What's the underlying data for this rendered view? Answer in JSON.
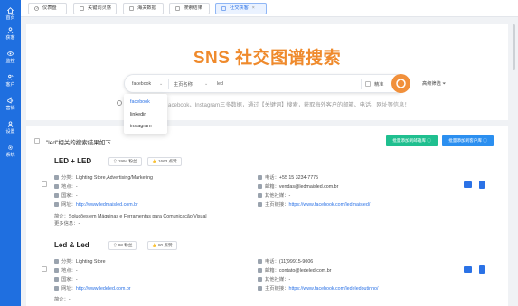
{
  "sidebar": {
    "items": [
      {
        "label": "首页",
        "icon": "home-icon"
      },
      {
        "label": "获客",
        "icon": "user-icon"
      },
      {
        "label": "监控",
        "icon": "eye-icon"
      },
      {
        "label": "客户",
        "icon": "customers-icon"
      },
      {
        "label": "营销",
        "icon": "marketing-icon"
      },
      {
        "label": "设置",
        "icon": "settings-icon"
      },
      {
        "label": "系统",
        "icon": "gear-icon"
      }
    ]
  },
  "tabs": [
    {
      "label": "仪表盘"
    },
    {
      "label": "关键词灵感"
    },
    {
      "label": "海关数据"
    },
    {
      "label": "搜索结果"
    },
    {
      "label": "社交获客",
      "close": "×"
    }
  ],
  "search": {
    "hero_title": "SNS 社交图谱搜索",
    "platform": "facebook",
    "field": "主页名称",
    "query": "led",
    "exact_label": "精准",
    "advanced_label": "高级筛选",
    "description": "acebook、Instagram三多数据，通过【关键词】搜索，获取海外客户的邮箱、电话、网址等信息！",
    "dropdown_options": [
      "facebook",
      "linkedin",
      "instagram"
    ]
  },
  "results": {
    "heading": "\"led\"相关的搜索结果如下",
    "btn_email": "批量添加到邮箱库 ⓘ",
    "btn_customers": "批量添加到客户库 ⓘ",
    "cards": [
      {
        "name": "LED + LED",
        "fans": "1994 粉丝",
        "likes": "1663 点赞",
        "category_label": "分类：",
        "category": "Lighting Store,Advertising/Marketing",
        "location_label": "地点：",
        "location": "-",
        "country_label": "国家：",
        "country": "-",
        "website_label": "网址：",
        "website": "http://www.ledmaisled.com.br",
        "phone_label": "电话：",
        "phone": "+55 15 3234-7775",
        "email_label": "邮箱：",
        "email": "vendas@ledmaisled.com.br",
        "social_label": "其他社媒：",
        "social": "-",
        "home_label": "主页链接：",
        "home": "https://www.facebook.com/ledmaisled/",
        "intro_label": "简介：",
        "intro": "Soluções em Máquinas e Ferramentas para Comunicação Visual",
        "more_label": "更多信息：",
        "more": "-"
      },
      {
        "name": "Led & Led",
        "fans": "98 粉丝",
        "likes": "80 点赞",
        "category_label": "分类：",
        "category": "Lighting Store",
        "location_label": "地点：",
        "location": "-",
        "country_label": "国家：",
        "country": "-",
        "website_label": "网址：",
        "website": "http://www.ledeled.com.br",
        "phone_label": "电话：",
        "phone": "(11)99915-9006",
        "email_label": "邮箱：",
        "email": "contato@ledeled.com.br",
        "social_label": "其他社媒：",
        "social": "-",
        "home_label": "主页链接：",
        "home": "https://www.facebook.com/ledeledoutinho/",
        "intro_label": "简介：",
        "intro": "-"
      }
    ]
  },
  "colors": {
    "sidebar": "#1f6fe0",
    "accent_orange": "#ef8a2c",
    "green": "#1fbf8f",
    "blue": "#2b8ff0"
  }
}
